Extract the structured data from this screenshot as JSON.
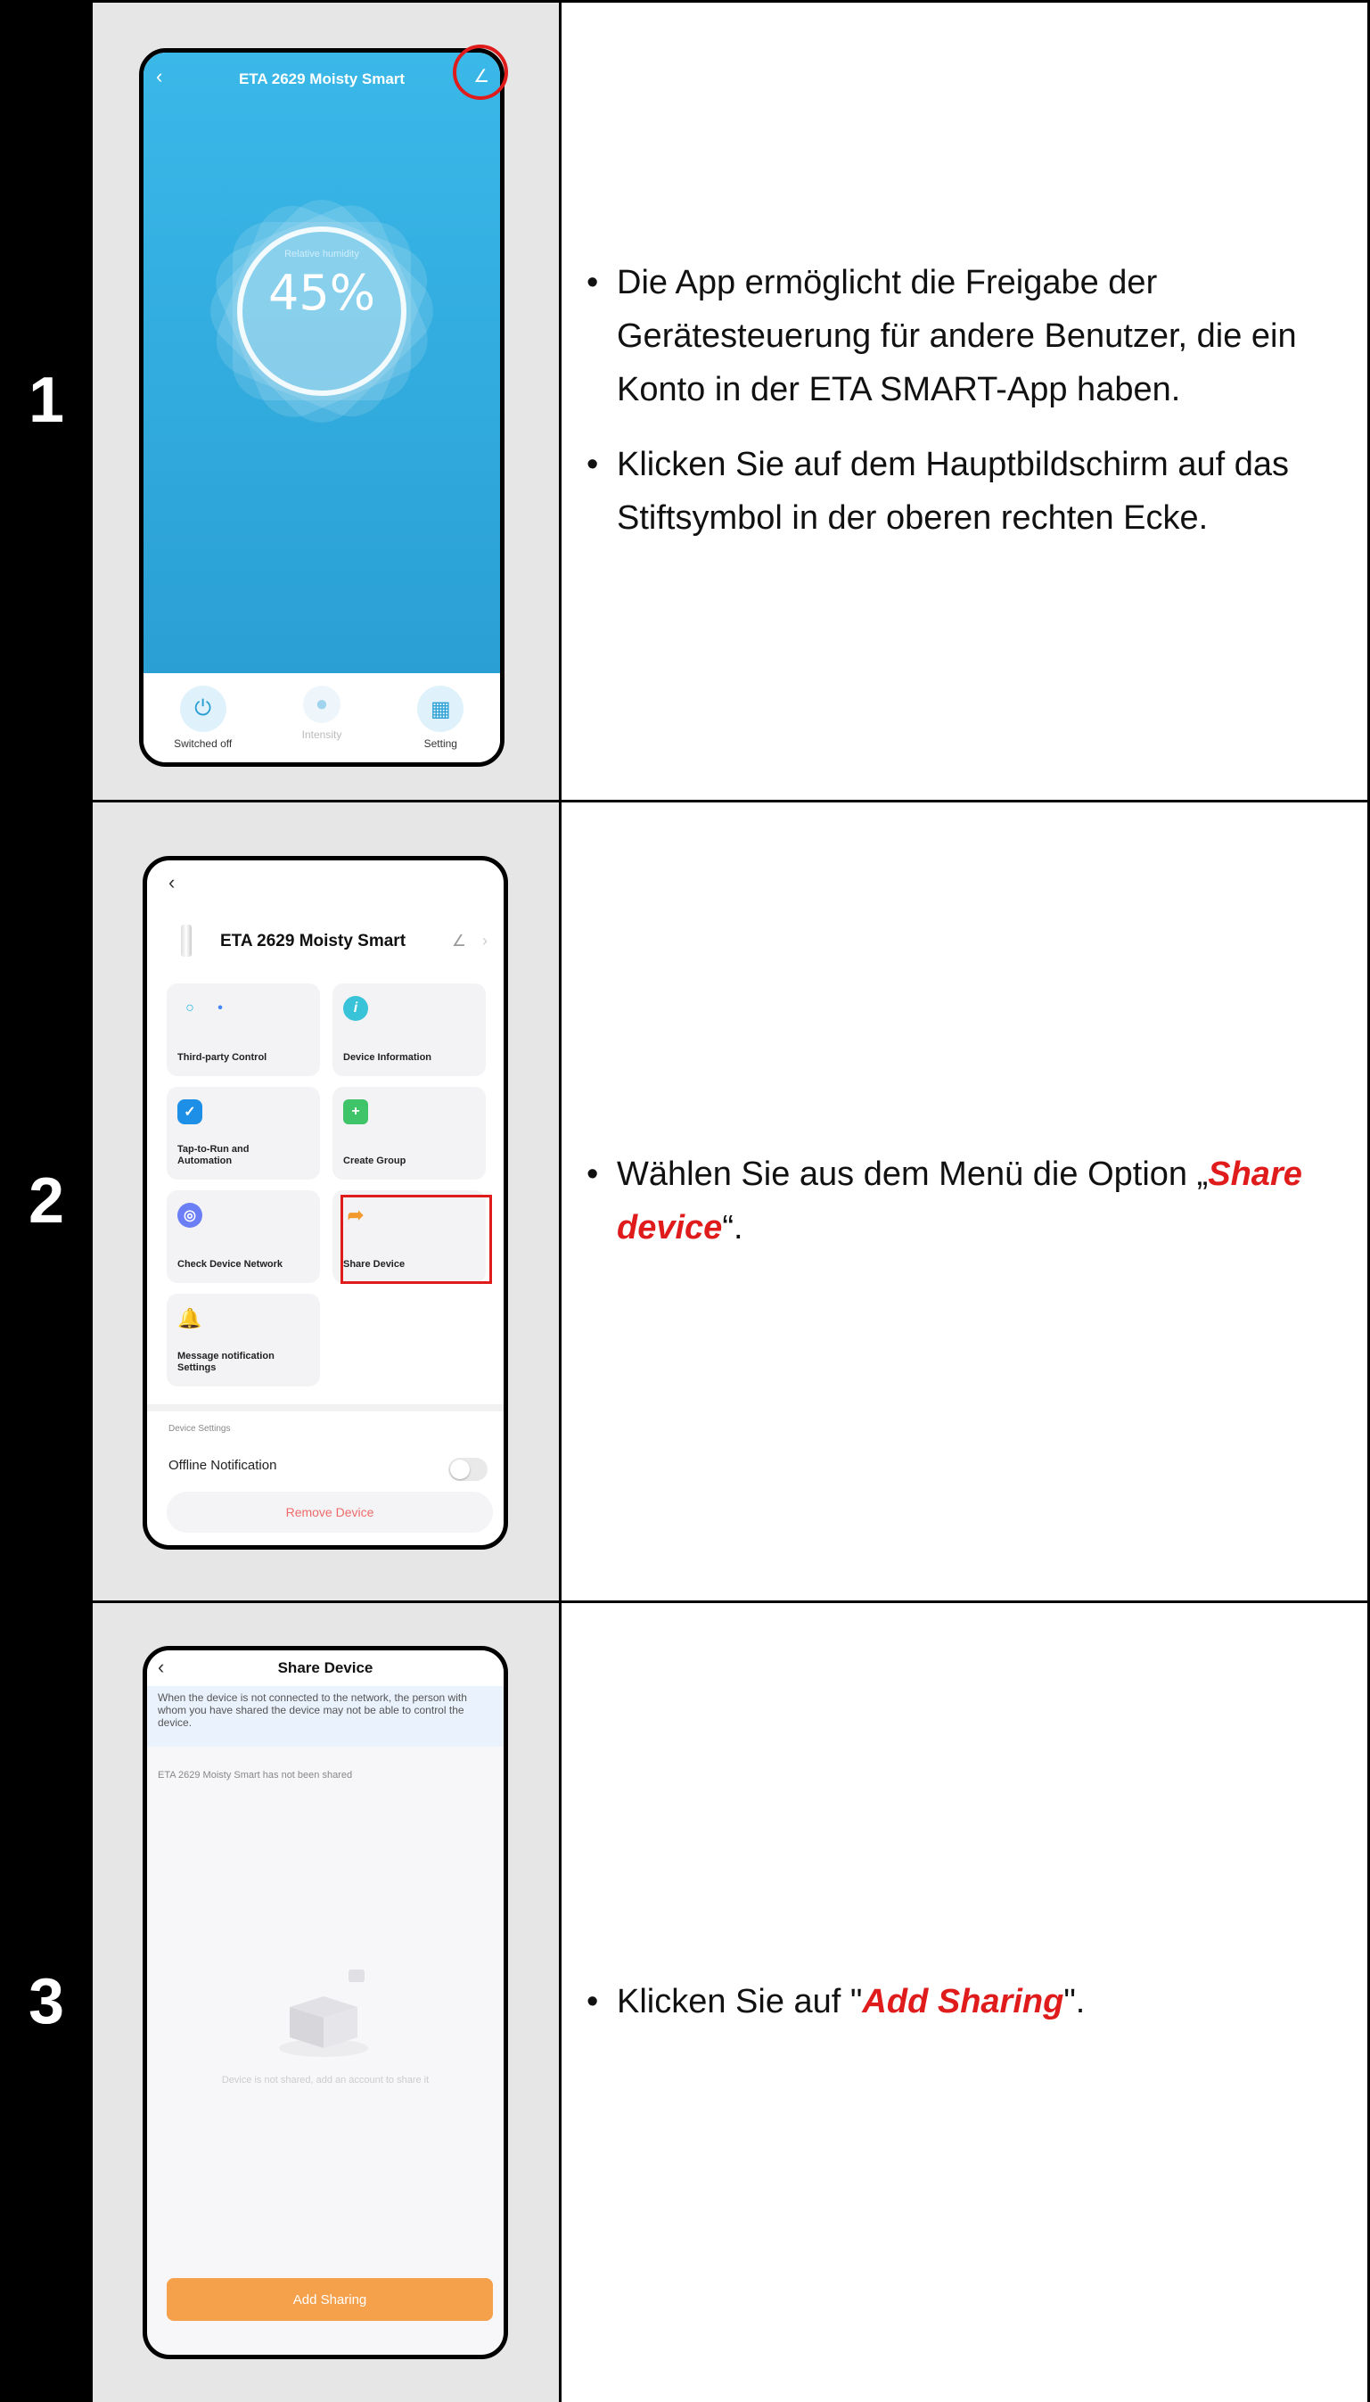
{
  "steps": [
    {
      "number": "1",
      "bullets": [
        "Die App ermöglicht die Freigabe der Gerätesteuerung für andere Benutzer, die ein Konto in der ETA SMART-App haben.",
        "Klicken Sie auf dem Hauptbildschirm auf das Stiftsymbol in der oberen rechten Ecke."
      ]
    },
    {
      "number": "2",
      "bullet_prefix": "Wählen Sie aus dem Menü die Option „",
      "bullet_highlight": "Share device",
      "bullet_suffix": "“."
    },
    {
      "number": "3",
      "bullet_prefix": "Klicken Sie auf \"",
      "bullet_highlight": "Add Sharing",
      "bullet_suffix": "\"."
    }
  ],
  "phone1": {
    "title": "ETA 2629 Moisty Smart",
    "humidity_label": "Relative humidity",
    "humidity_value": "45%",
    "buttons": [
      "Switched off",
      "Intensity",
      "Setting"
    ]
  },
  "phone2": {
    "device_name": "ETA 2629 Moisty Smart",
    "tiles": [
      "Third-party Control",
      "Device Information",
      "Tap-to-Run and Automation",
      "Create Group",
      "Check Device Network",
      "Share Device",
      "Message notification Settings"
    ],
    "device_settings_label": "Device Settings",
    "offline_notification": "Offline Notification",
    "remove_device": "Remove Device"
  },
  "phone3": {
    "title": "Share Device",
    "note": "When the device is not connected to the network, the person with whom you have shared the device may not be able to control the device.",
    "not_shared": "ETA 2629 Moisty Smart has not been shared",
    "empty_text": "Device is not shared, add an account to share it",
    "add_button": "Add Sharing"
  },
  "colors": {
    "highlight": "#e01b1b",
    "app_blue": "#2a9fd4",
    "add_orange": "#f5a04a"
  },
  "icons": [
    "back-chevron-icon",
    "pen-icon",
    "power-icon",
    "drop-icon",
    "grid-icon",
    "alexa-icon",
    "assistant-icon",
    "info-icon",
    "check-icon",
    "group-icon",
    "network-icon",
    "share-arrow-icon",
    "bell-icon",
    "empty-box-icon"
  ]
}
